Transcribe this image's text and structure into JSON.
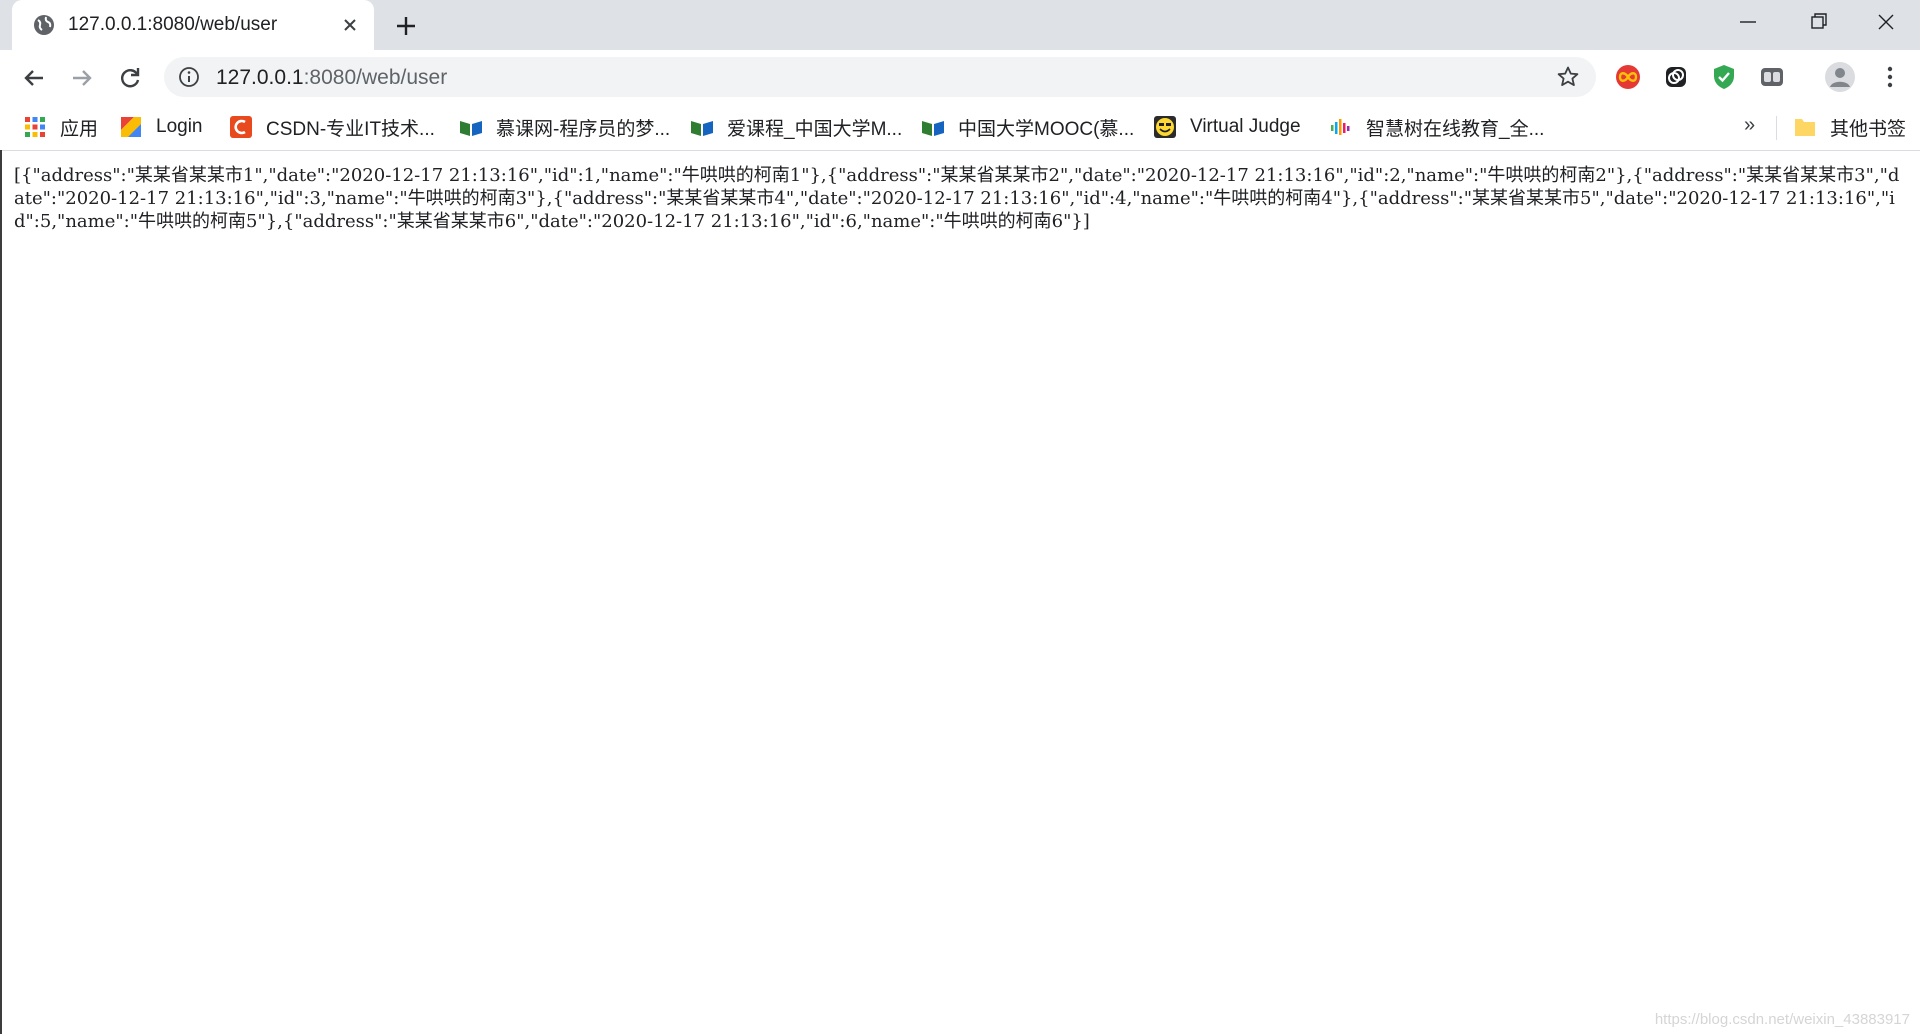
{
  "tab": {
    "title": "127.0.0.1:8080/web/user",
    "favicon": "globe-icon"
  },
  "toolbar": {
    "url_host": "127.0.0.1",
    "url_rest": ":8080/web/user",
    "extensions": [
      "red-infinity-extension-icon",
      "link-extension-icon",
      "green-shield-extension-icon",
      "grid-extension-icon"
    ]
  },
  "bookmarks": {
    "apps": "应用",
    "items": [
      {
        "label": "Login",
        "icon": "login-bookmark-icon"
      },
      {
        "label": "CSDN-专业IT技术...",
        "icon": "csdn-icon"
      },
      {
        "label": "慕课网-程序员的梦...",
        "icon": "imooc-icon"
      },
      {
        "label": "爱课程_中国大学M...",
        "icon": "icourse-icon"
      },
      {
        "label": "中国大学MOOC(慕...",
        "icon": "mooc-icon"
      },
      {
        "label": "Virtual Judge",
        "icon": "vjudge-icon"
      },
      {
        "label": "智慧树在线教育_全...",
        "icon": "zhihuishu-icon"
      }
    ],
    "overflow": "»",
    "other": "其他书签"
  },
  "content": {
    "json_text": "[{\"address\":\"某某省某某市1\",\"date\":\"2020-12-17 21:13:16\",\"id\":1,\"name\":\"牛哄哄的柯南1\"},{\"address\":\"某某省某某市2\",\"date\":\"2020-12-17 21:13:16\",\"id\":2,\"name\":\"牛哄哄的柯南2\"},{\"address\":\"某某省某某市3\",\"date\":\"2020-12-17 21:13:16\",\"id\":3,\"name\":\"牛哄哄的柯南3\"},{\"address\":\"某某省某某市4\",\"date\":\"2020-12-17 21:13:16\",\"id\":4,\"name\":\"牛哄哄的柯南4\"},{\"address\":\"某某省某某市5\",\"date\":\"2020-12-17 21:13:16\",\"id\":5,\"name\":\"牛哄哄的柯南5\"},{\"address\":\"某某省某某市6\",\"date\":\"2020-12-17 21:13:16\",\"id\":6,\"name\":\"牛哄哄的柯南6\"}]"
  },
  "watermark": "https://blog.csdn.net/weixin_43883917"
}
